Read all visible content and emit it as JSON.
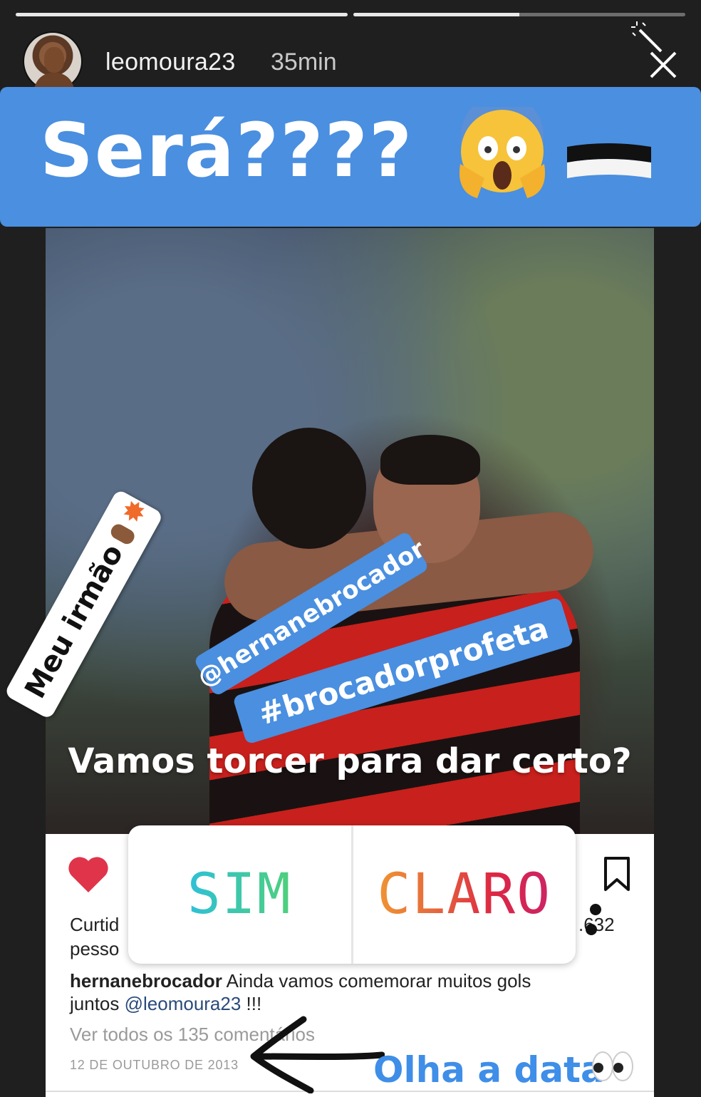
{
  "story": {
    "progress": [
      1.0,
      0.5
    ],
    "username": "leomoura23",
    "time_ago": "35min"
  },
  "banner": {
    "text": "Será????"
  },
  "stickers": {
    "irmao": "Meu irmão",
    "mention_tag": "@hernanebrocador",
    "hashtag": "#brocadorprofeta",
    "question": "Vamos torcer para dar certo?"
  },
  "poll": {
    "option_1": "SIM",
    "option_2": "CLARO"
  },
  "post": {
    "likes_line_1": "Curtid",
    "likes_line_2": "pesso",
    "likes_count_fragment": ".632",
    "author": "hernanebrocador",
    "caption_text": " Ainda vamos comemorar muitos gols",
    "caption_line2_prefix": "juntos ",
    "caption_mention": "@leomoura23",
    "caption_suffix": " !!!",
    "comments_link": "Ver todos os 135 comentários",
    "date": "12 DE OUTUBRO DE 2013"
  },
  "annotation": {
    "text": "Olha a data"
  },
  "colors": {
    "banner_blue": "#4a8fe0",
    "heart_red": "#e0344a",
    "annotation_blue": "#3f8ee8"
  }
}
